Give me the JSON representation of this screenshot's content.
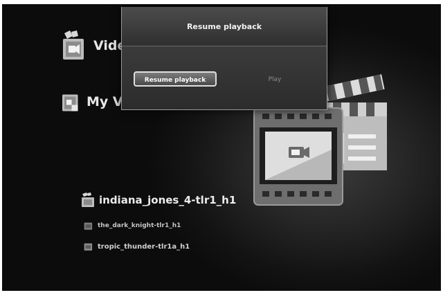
{
  "menu": {
    "videos_label": "Vide",
    "my_videos_label": "My Vid"
  },
  "dialog": {
    "title": "Resume playback",
    "resume_button": "Resume playback",
    "play_button": "Play"
  },
  "files": [
    {
      "name": "indiana_jones_4-tlr1_h1"
    },
    {
      "name": "the_dark_knight-tlr1_h1"
    },
    {
      "name": "tropic_thunder-tlr1a_h1"
    }
  ],
  "icons": {
    "videos": "video-folder-icon",
    "my_videos": "video-folder-icon",
    "file": "film-clip-icon",
    "artwork": "clapperboard-film-icon"
  },
  "colors": {
    "background": "#141414",
    "dialog": "#3a3a3a",
    "text": "#e6e6e6",
    "dim_text": "#8c8c8c"
  }
}
